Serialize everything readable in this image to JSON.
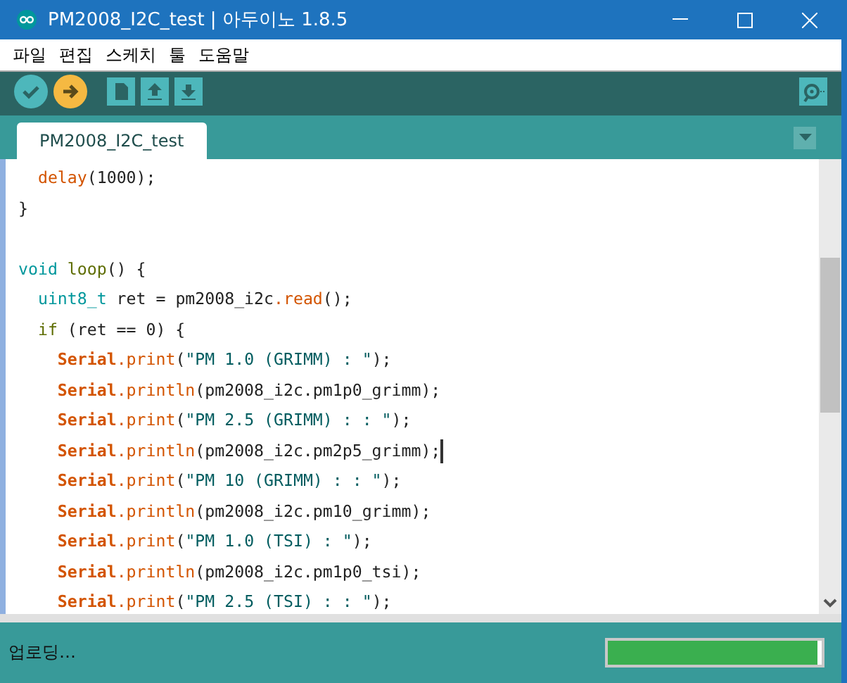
{
  "window": {
    "title": "PM2008_I2C_test | 아두이노 1.8.5"
  },
  "menu": [
    "파일",
    "편집",
    "스케치",
    "툴",
    "도움말"
  ],
  "tabs": [
    {
      "label": "PM2008_I2C_test",
      "selected": true
    }
  ],
  "editor": {
    "lines": [
      {
        "kind": "code",
        "cursor": false,
        "tokens": [
          {
            "kind": "func",
            "text": "  delay"
          },
          {
            "kind": "plain",
            "text": "(1000);"
          }
        ]
      },
      {
        "kind": "code",
        "cursor": false,
        "tokens": [
          {
            "kind": "plain",
            "text": "}"
          }
        ]
      },
      {
        "kind": "blank"
      },
      {
        "kind": "code",
        "cursor": false,
        "tokens": [
          {
            "kind": "type",
            "text": "void "
          },
          {
            "kind": "ctrl",
            "text": "loop"
          },
          {
            "kind": "plain",
            "text": "() {"
          }
        ]
      },
      {
        "kind": "code",
        "cursor": false,
        "tokens": [
          {
            "kind": "type",
            "text": "  uint8_t"
          },
          {
            "kind": "plain",
            "text": " ret = pm2008_i2c"
          },
          {
            "kind": "func",
            "text": ".read"
          },
          {
            "kind": "plain",
            "text": "();"
          }
        ]
      },
      {
        "kind": "code",
        "cursor": false,
        "tokens": [
          {
            "kind": "ctrl",
            "text": "  if"
          },
          {
            "kind": "plain",
            "text": " (ret == 0) {"
          }
        ]
      },
      {
        "kind": "code",
        "cursor": false,
        "tokens": [
          {
            "kind": "class",
            "text": "    Serial"
          },
          {
            "kind": "func",
            "text": ".print"
          },
          {
            "kind": "plain",
            "text": "("
          },
          {
            "kind": "str",
            "text": "\"PM 1.0 (GRIMM) : \""
          },
          {
            "kind": "plain",
            "text": ");"
          }
        ]
      },
      {
        "kind": "code",
        "cursor": false,
        "tokens": [
          {
            "kind": "class",
            "text": "    Serial"
          },
          {
            "kind": "func",
            "text": ".println"
          },
          {
            "kind": "plain",
            "text": "(pm2008_i2c.pm1p0_grimm);"
          }
        ]
      },
      {
        "kind": "code",
        "cursor": false,
        "tokens": [
          {
            "kind": "class",
            "text": "    Serial"
          },
          {
            "kind": "func",
            "text": ".print"
          },
          {
            "kind": "plain",
            "text": "("
          },
          {
            "kind": "str",
            "text": "\"PM 2.5 (GRIMM) : : \""
          },
          {
            "kind": "plain",
            "text": ");"
          }
        ]
      },
      {
        "kind": "code",
        "cursor": true,
        "tokens": [
          {
            "kind": "class",
            "text": "    Serial"
          },
          {
            "kind": "func",
            "text": ".println"
          },
          {
            "kind": "plain",
            "text": "(pm2008_i2c.pm2p5_grimm);"
          }
        ]
      },
      {
        "kind": "code",
        "cursor": false,
        "tokens": [
          {
            "kind": "class",
            "text": "    Serial"
          },
          {
            "kind": "func",
            "text": ".print"
          },
          {
            "kind": "plain",
            "text": "("
          },
          {
            "kind": "str",
            "text": "\"PM 10 (GRIMM) : : \""
          },
          {
            "kind": "plain",
            "text": ");"
          }
        ]
      },
      {
        "kind": "code",
        "cursor": false,
        "tokens": [
          {
            "kind": "class",
            "text": "    Serial"
          },
          {
            "kind": "func",
            "text": ".println"
          },
          {
            "kind": "plain",
            "text": "(pm2008_i2c.pm10_grimm);"
          }
        ]
      },
      {
        "kind": "code",
        "cursor": false,
        "tokens": [
          {
            "kind": "class",
            "text": "    Serial"
          },
          {
            "kind": "func",
            "text": ".print"
          },
          {
            "kind": "plain",
            "text": "("
          },
          {
            "kind": "str",
            "text": "\"PM 1.0 (TSI) : \""
          },
          {
            "kind": "plain",
            "text": ");"
          }
        ]
      },
      {
        "kind": "code",
        "cursor": false,
        "tokens": [
          {
            "kind": "class",
            "text": "    Serial"
          },
          {
            "kind": "func",
            "text": ".println"
          },
          {
            "kind": "plain",
            "text": "(pm2008_i2c.pm1p0_tsi);"
          }
        ]
      },
      {
        "kind": "code",
        "cursor": false,
        "tokens": [
          {
            "kind": "class",
            "text": "    Serial"
          },
          {
            "kind": "func",
            "text": ".print"
          },
          {
            "kind": "plain",
            "text": "("
          },
          {
            "kind": "str",
            "text": "\"PM 2.5 (TSI) : : \""
          },
          {
            "kind": "plain",
            "text": ");"
          }
        ]
      }
    ]
  },
  "status_bar": {
    "message": "업로딩…",
    "progress": {
      "level": 0.98
    }
  }
}
